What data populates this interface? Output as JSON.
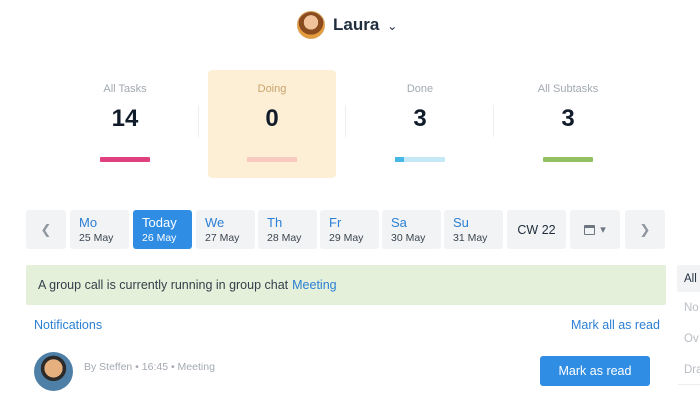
{
  "header": {
    "user_name": "Laura",
    "user_avatar_icon": "avatar-photo",
    "menu_icon": "chevron-down-icon"
  },
  "stats": [
    {
      "label": "All Tasks",
      "count": "14",
      "bar_color": "#e0407e",
      "progress": 1.0
    },
    {
      "label": "Doing",
      "count": "0",
      "bar_color": "#f7c9bf",
      "progress": 1.0
    },
    {
      "label": "Done",
      "count": "3",
      "bar_color": "#c5e8f6",
      "fill_color": "#45b8e6",
      "progress": 0.18
    },
    {
      "label": "All Subtasks",
      "count": "3",
      "bar_color": "#93c162",
      "progress": 1.0
    }
  ],
  "date_strip": {
    "prev_icon": "chevron-left-icon",
    "next_icon": "chevron-right-icon",
    "days": [
      {
        "name": "Mo",
        "date": "25 May",
        "active": false
      },
      {
        "name": "Today",
        "date": "26 May",
        "active": true
      },
      {
        "name": "We",
        "date": "27 May",
        "active": false
      },
      {
        "name": "Th",
        "date": "28 May",
        "active": false
      },
      {
        "name": "Fr",
        "date": "29 May",
        "active": false
      },
      {
        "name": "Sa",
        "date": "30 May",
        "active": false
      },
      {
        "name": "Su",
        "date": "31 May",
        "active": false
      }
    ],
    "week": "CW 22",
    "calendar_icon": "calendar-icon",
    "calendar_caret": "▾"
  },
  "banner": {
    "text": "A group call is currently running in group chat",
    "link": "Meeting"
  },
  "side_filters": [
    "All",
    "No",
    "Ov",
    "Dra"
  ],
  "notifications": {
    "title": "Notifications",
    "mark_all": "Mark all as read",
    "items": [
      {
        "meta": "By Steffen • 16:45 • Meeting",
        "button": "Mark as read"
      }
    ]
  },
  "colors": {
    "accent": "#2f8de4",
    "link": "#2a7fd4",
    "banner_bg": "#e5f0da",
    "doing_bg": "#fdeed6"
  }
}
